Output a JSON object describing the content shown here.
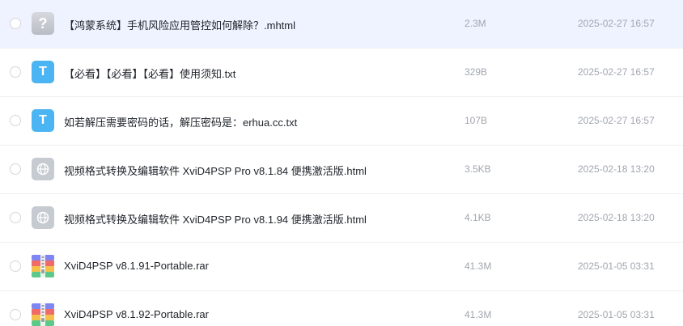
{
  "files": [
    {
      "name": "【鸿蒙系统】手机风险应用管控如何解除？.mhtml",
      "size": "2.3M",
      "date": "2025-02-27 16:57",
      "icon": "unknown-file-icon",
      "icon_glyph": "?"
    },
    {
      "name": "【必看】【必看】【必看】使用须知.txt",
      "size": "329B",
      "date": "2025-02-27 16:57",
      "icon": "txt-file-icon",
      "icon_glyph": "T"
    },
    {
      "name": "如若解压需要密码的话，解压密码是：erhua.cc.txt",
      "size": "107B",
      "date": "2025-02-27 16:57",
      "icon": "txt-file-icon",
      "icon_glyph": "T"
    },
    {
      "name": "视频格式转换及编辑软件 XviD4PSP Pro v8.1.84 便携激活版.html",
      "size": "3.5KB",
      "date": "2025-02-18 13:20",
      "icon": "html-file-icon"
    },
    {
      "name": "视频格式转换及编辑软件 XviD4PSP Pro v8.1.94 便携激活版.html",
      "size": "4.1KB",
      "date": "2025-02-18 13:20",
      "icon": "html-file-icon"
    },
    {
      "name": "XviD4PSP v8.1.91-Portable.rar",
      "size": "41.3M",
      "date": "2025-01-05 03:31",
      "icon": "rar-archive-icon"
    },
    {
      "name": "XviD4PSP v8.1.92-Portable.rar",
      "size": "41.3M",
      "date": "2025-01-05 03:31",
      "icon": "rar-archive-icon"
    }
  ],
  "colors": {
    "selected_row_bg": "#eef3ff",
    "txt_icon": "#4ab5f2",
    "secondary_text": "#a1a6ae"
  }
}
